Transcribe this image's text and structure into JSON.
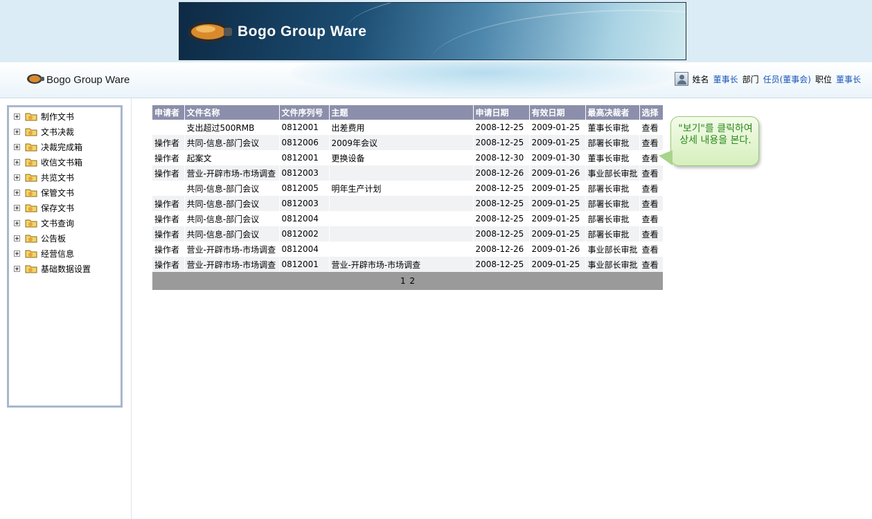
{
  "banner": {
    "title": "Bogo Group Ware"
  },
  "subheader": {
    "title": "Bogo Group Ware",
    "user": {
      "name_label": "姓名",
      "name_value": "董事长",
      "dept_label": "部门",
      "dept_value": "任员(董事会)",
      "position_label": "职位",
      "position_value": "董事长"
    }
  },
  "sidebar": {
    "items": [
      {
        "label": "制作文书"
      },
      {
        "label": "文书决裁"
      },
      {
        "label": "决裁完成箱"
      },
      {
        "label": "收信文书箱"
      },
      {
        "label": "共览文书"
      },
      {
        "label": "保管文书"
      },
      {
        "label": "保存文书"
      },
      {
        "label": "文书查询"
      },
      {
        "label": "公告板"
      },
      {
        "label": "经营信息"
      },
      {
        "label": "基础数据设置"
      }
    ]
  },
  "table": {
    "headers": [
      "申请者",
      "文件名称",
      "文件序列号",
      "主题",
      "申请日期",
      "有效日期",
      "最高决裁者",
      "选择"
    ],
    "rows": [
      [
        "",
        "支出超过500RMB",
        "0812001",
        "出差费用",
        "2008-12-25",
        "2009-01-25",
        "董事长审批",
        "查看"
      ],
      [
        "操作者",
        "共同-信息-部门会议",
        "0812006",
        "2009年会议",
        "2008-12-25",
        "2009-01-25",
        "部署长审批",
        "查看"
      ],
      [
        "操作者",
        "起案文",
        "0812001",
        "更换设备",
        "2008-12-30",
        "2009-01-30",
        "董事长审批",
        "查看"
      ],
      [
        "操作者",
        "营业-开辟市场-市场调查",
        "0812003",
        "",
        "2008-12-26",
        "2009-01-26",
        "事业部长审批",
        "查看"
      ],
      [
        "",
        "共同-信息-部门会议",
        "0812005",
        "明年生产计划",
        "2008-12-25",
        "2009-01-25",
        "部署长审批",
        "查看"
      ],
      [
        "操作者",
        "共同-信息-部门会议",
        "0812003",
        "",
        "2008-12-25",
        "2009-01-25",
        "部署长审批",
        "查看"
      ],
      [
        "操作者",
        "共同-信息-部门会议",
        "0812004",
        "",
        "2008-12-25",
        "2009-01-25",
        "部署长审批",
        "查看"
      ],
      [
        "操作者",
        "共同-信息-部门会议",
        "0812002",
        "",
        "2008-12-25",
        "2009-01-25",
        "部署长审批",
        "查看"
      ],
      [
        "操作者",
        "营业-开辟市场-市场调查",
        "0812004",
        "",
        "2008-12-26",
        "2009-01-26",
        "事业部长审批",
        "查看"
      ],
      [
        "操作者",
        "营业-开辟市场-市场调查",
        "0812001",
        "营业-开辟市场-市场调查",
        "2008-12-25",
        "2009-01-25",
        "事业部长审批",
        "查看"
      ]
    ],
    "pages": [
      "1",
      "2"
    ]
  },
  "callout": {
    "text": "\"보기\"를 클릭하여 상세 내용을 본다."
  }
}
